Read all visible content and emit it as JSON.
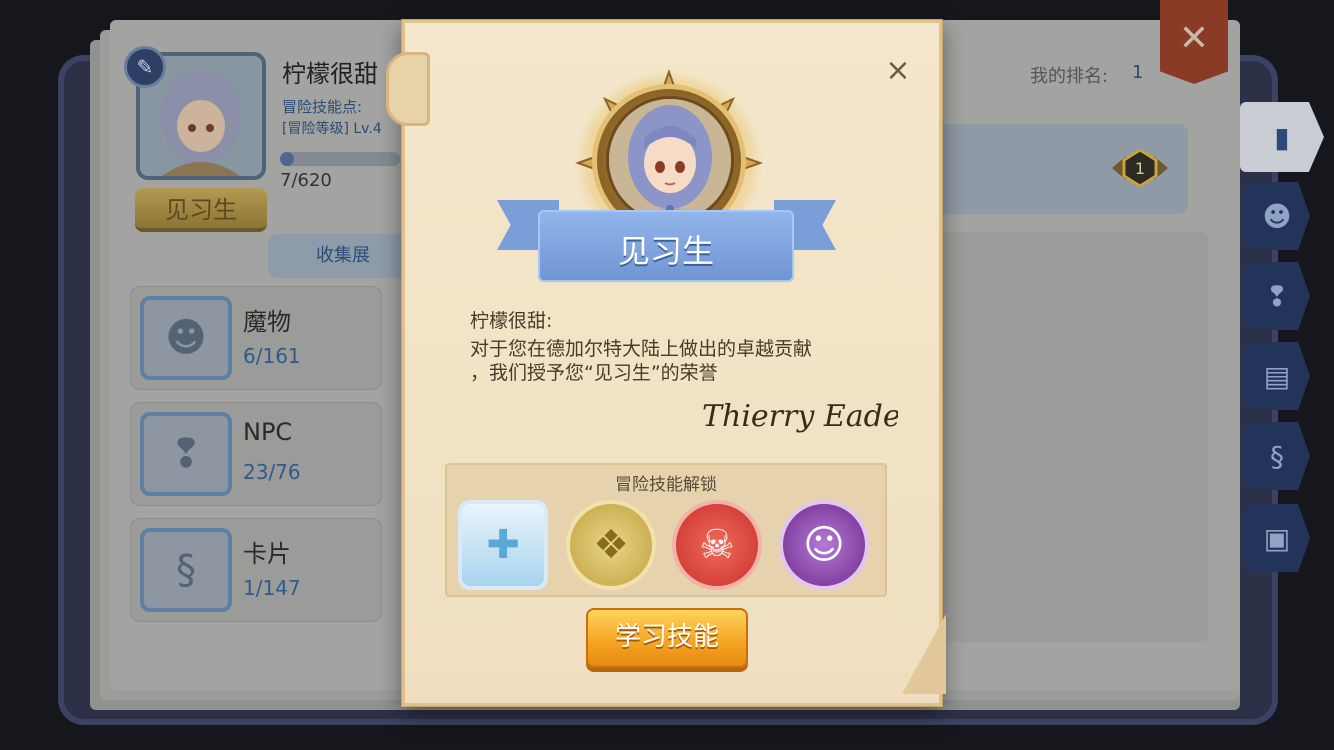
{
  "background": {
    "player_name": "柠檬很甜",
    "skill_points_label": "冒险技能点:",
    "level_label": "[冒险等级] Lv.4",
    "progress_text": "7/620",
    "progress_fraction": 0.011,
    "rank_title": "见习生",
    "collect_tab": "收集展",
    "my_rank_label": "我的排名:",
    "my_rank_value": "1",
    "rank_badge_value": "1",
    "categories": [
      {
        "title": "魔物",
        "count": "6/161",
        "icon": "monster-icon"
      },
      {
        "title": "NPC",
        "count": "23/76",
        "icon": "npc-icon"
      },
      {
        "title": "卡片",
        "count": "1/147",
        "icon": "card-icon"
      }
    ],
    "side_tabs": [
      "book-icon",
      "monster-face-icon",
      "npc-alert-icon",
      "open-book-icon",
      "card-icon",
      "suitcase-icon"
    ]
  },
  "dialog": {
    "close_symbol": "×",
    "title": "见习生",
    "recipient": "柠檬很甜:",
    "message_line1": "对于您在德加尔特大陆上做出的卓越贡献",
    "message_line2": "，我们授予您“见习生”的荣誉",
    "signature": "Thierry Eades",
    "unlock_title": "冒险技能解锁",
    "skills": [
      "holy-cross-icon",
      "backpack-icon",
      "skull-target-icon",
      "laughing-face-icon"
    ],
    "learn_button": "学习技能"
  },
  "colors": {
    "ribbon": "#7a9ed8",
    "button": "#f5a221",
    "parchment": "#f4e7cc"
  }
}
